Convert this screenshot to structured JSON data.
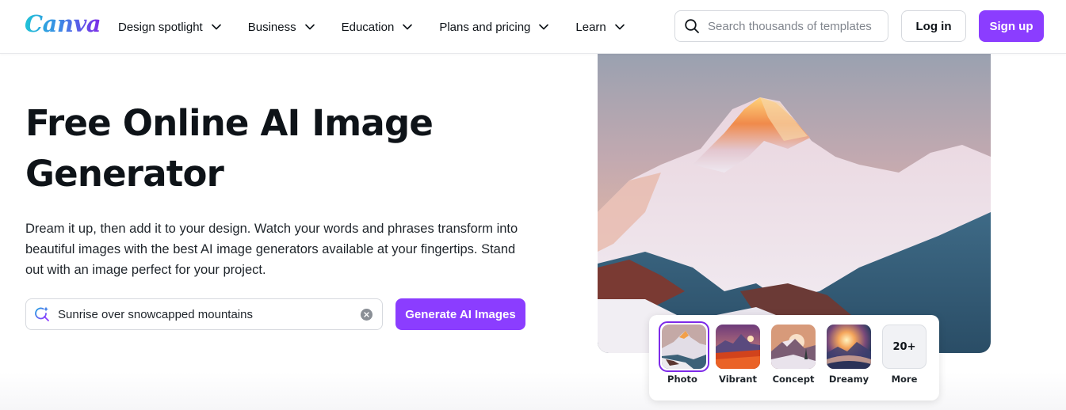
{
  "header": {
    "logo": "Canva",
    "nav": [
      {
        "label": "Design spotlight"
      },
      {
        "label": "Business"
      },
      {
        "label": "Education"
      },
      {
        "label": "Plans and pricing"
      },
      {
        "label": "Learn"
      }
    ],
    "search_placeholder": "Search thousands of templates",
    "login_label": "Log in",
    "signup_label": "Sign up"
  },
  "hero": {
    "title": "Free Online AI Image Generator",
    "description": "Dream it up, then add it to your design. Watch your words and phrases transform into beautiful images with the best AI image generators available at your fingertips. Stand out with an image perfect for your project.",
    "prompt_value": "Sunrise over snowcapped mountains",
    "generate_label": "Generate AI Images"
  },
  "styles": {
    "items": [
      {
        "label": "Photo",
        "selected": true
      },
      {
        "label": "Vibrant",
        "selected": false
      },
      {
        "label": "Concept",
        "selected": false
      },
      {
        "label": "Dreamy",
        "selected": false
      }
    ],
    "more": {
      "badge": "20+",
      "label": "More"
    }
  },
  "colors": {
    "brand_purple": "#8b3dff",
    "selected_border": "#7d2ae8",
    "text": "#0e1318"
  }
}
